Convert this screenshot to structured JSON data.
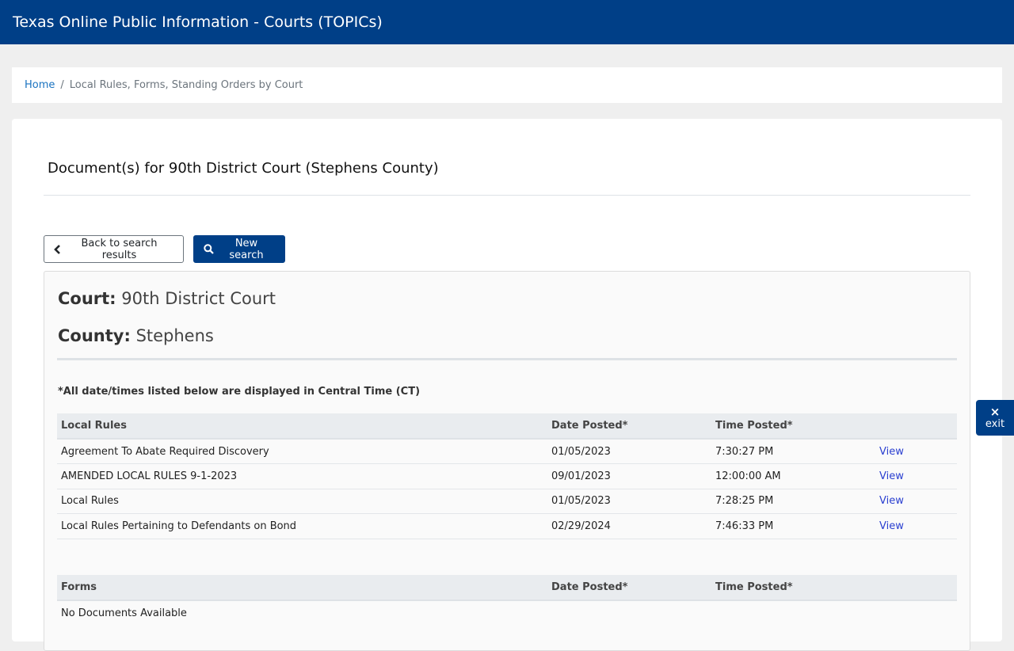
{
  "header": {
    "title": "Texas Online Public Information - Courts (TOPICs)"
  },
  "breadcrumb": {
    "home": "Home",
    "separator": "/",
    "current": "Local Rules, Forms, Standing Orders by Court"
  },
  "page": {
    "title": "Document(s) for 90th District Court (Stephens County)",
    "back_button": "Back to search results",
    "new_search_button": "New search"
  },
  "details": {
    "court_label": "Court:",
    "court_value": "90th District Court",
    "county_label": "County:",
    "county_value": "Stephens",
    "tz_note": "*All date/times listed below are displayed in Central Time (CT)"
  },
  "local_rules": {
    "headers": [
      "Local Rules",
      "Date Posted*",
      "Time Posted*",
      ""
    ],
    "rows": [
      {
        "name": "Agreement To Abate Required Discovery",
        "date": "01/05/2023",
        "time": "7:30:27 PM",
        "action": "View"
      },
      {
        "name": "AMENDED LOCAL RULES 9-1-2023",
        "date": "09/01/2023",
        "time": "12:00:00 AM",
        "action": "View"
      },
      {
        "name": "Local Rules",
        "date": "01/05/2023",
        "time": "7:28:25 PM",
        "action": "View"
      },
      {
        "name": "Local Rules Pertaining to Defendants on Bond",
        "date": "02/29/2024",
        "time": "7:46:33 PM",
        "action": "View"
      }
    ]
  },
  "forms": {
    "headers": [
      "Forms",
      "Date Posted*",
      "Time Posted*",
      ""
    ],
    "empty_text": "No Documents Available"
  },
  "exit": {
    "symbol": "×",
    "label": "exit"
  },
  "colors": {
    "brand": "#003f87",
    "link": "#1a73c0",
    "view_link": "#2a3fd0"
  },
  "icons": {
    "back": "chevron-left-icon",
    "search": "search-icon",
    "exit": "close-icon"
  }
}
